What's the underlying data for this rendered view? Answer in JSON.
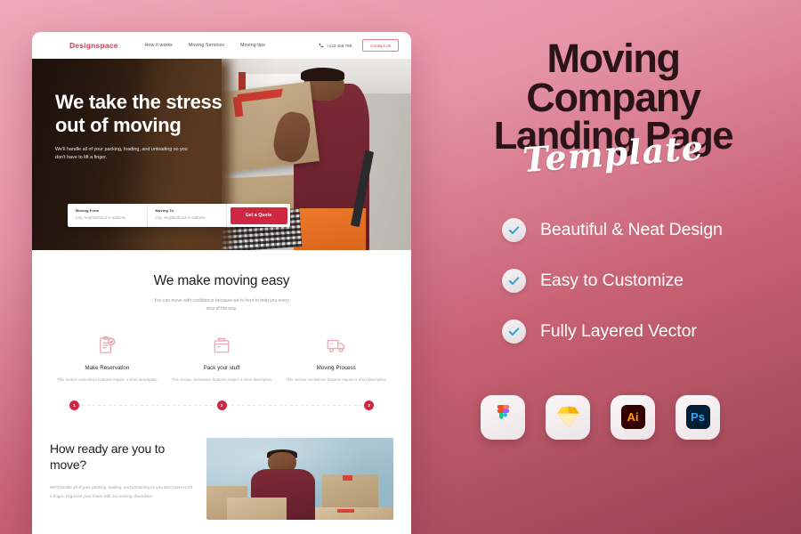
{
  "theme": {
    "accent_red": "#cf2742",
    "brand_red": "#d63a53",
    "promo_bg_top": "#f0a8b8",
    "promo_bg_bottom": "#97404f",
    "check_blue": "#2f9fd9"
  },
  "mockup": {
    "nav": {
      "brand": "Designspace",
      "links": [
        "How it works",
        "Moving Services",
        "Moving tips"
      ],
      "phone": "+123 456 789",
      "contact_label": "Contact Us"
    },
    "hero": {
      "heading": "We take the stress out of moving",
      "subtext": "We'll handle all of your packing, loading, and unloading so you don't have to lift a finger.",
      "search": {
        "from_label": "Moving From",
        "from_placeholder": "City, neighborhood or address",
        "to_label": "Moving To",
        "to_placeholder": "City, neighborhood or address",
        "cta_label": "Get a Quote"
      }
    },
    "easy_section": {
      "heading": "We make moving easy",
      "subtext": "You can move with confidence because we're here to help you every step of the way.",
      "features": [
        {
          "icon": "clipboard-check-icon",
          "title": "Make Reservation",
          "description": "This section sometimes features require a short description"
        },
        {
          "icon": "box-icon",
          "title": "Pack your stuff",
          "description": "This section sometimes features require a short description"
        },
        {
          "icon": "truck-icon",
          "title": "Moving Process",
          "description": "This section sometimes features require a short description"
        }
      ],
      "steps": [
        "1",
        "2",
        "3"
      ]
    },
    "ready_section": {
      "heading": "How ready are you to move?",
      "subtext": "We'll handle all of your packing, loading, and unloading so you don't have to lift a finger. Organize your move with our moving checklists!"
    }
  },
  "promo": {
    "title_lines": [
      "Moving",
      "Company",
      "Landing Page"
    ],
    "script_word": "Template",
    "features": [
      {
        "icon": "check-circle-icon",
        "label": "Beautiful & Neat Design"
      },
      {
        "icon": "check-circle-icon",
        "label": "Easy to Customize"
      },
      {
        "icon": "check-circle-icon",
        "label": "Fully Layered Vector"
      }
    ],
    "apps": [
      {
        "icon": "figma-icon",
        "label": ""
      },
      {
        "icon": "sketch-icon",
        "label": ""
      },
      {
        "icon": "illustrator-icon",
        "label": "Ai"
      },
      {
        "icon": "photoshop-icon",
        "label": "Ps"
      }
    ]
  }
}
